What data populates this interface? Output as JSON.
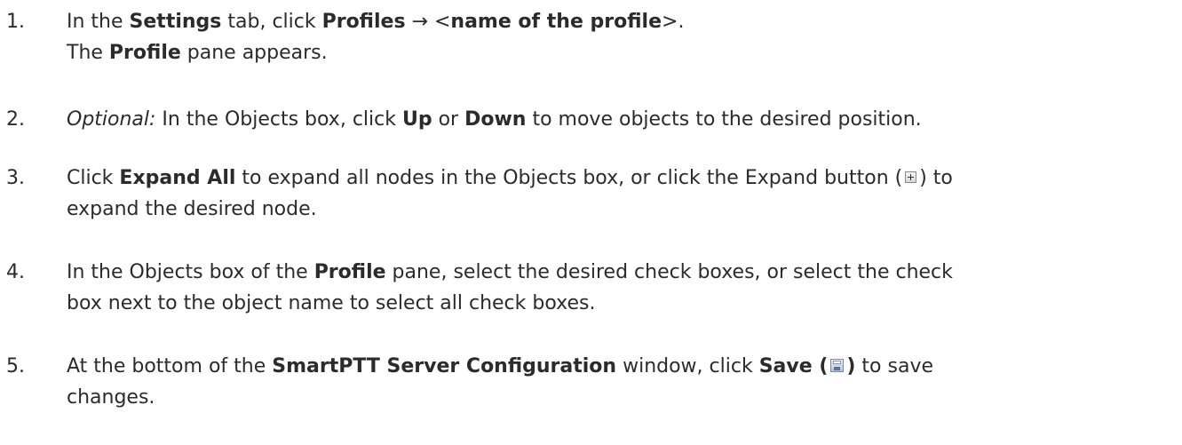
{
  "steps": [
    {
      "number": "1.",
      "lines": [
        [
          {
            "t": "In the ",
            "s": ""
          },
          {
            "t": "Settings",
            "s": "b"
          },
          {
            "t": " tab, click ",
            "s": ""
          },
          {
            "t": "Profiles",
            "s": "b"
          },
          {
            "t": " → <",
            "s": ""
          },
          {
            "t": "name of the profile",
            "s": "b"
          },
          {
            "t": ">.",
            "s": ""
          }
        ],
        [
          {
            "t": "The ",
            "s": ""
          },
          {
            "t": "Profile",
            "s": "b"
          },
          {
            "t": " pane appears.",
            "s": ""
          }
        ]
      ]
    },
    {
      "number": "2.",
      "lines": [
        [
          {
            "t": "Optional:",
            "s": "i"
          },
          {
            "t": " In the Objects box, click ",
            "s": ""
          },
          {
            "t": "Up",
            "s": "b"
          },
          {
            "t": " or ",
            "s": ""
          },
          {
            "t": "Down",
            "s": "b"
          },
          {
            "t": " to move objects to the desired position.",
            "s": ""
          }
        ]
      ]
    },
    {
      "number": "3.",
      "lines": [
        [
          {
            "t": "Click ",
            "s": ""
          },
          {
            "t": "Expand All",
            "s": "b"
          },
          {
            "t": " to expand all nodes in the Objects box, or click the Expand button (",
            "s": ""
          },
          {
            "icon": "expand-icon"
          },
          {
            "t": ") to",
            "s": ""
          }
        ],
        [
          {
            "t": "expand the desired node.",
            "s": ""
          }
        ]
      ]
    },
    {
      "number": "4.",
      "lines": [
        [
          {
            "t": "In the Objects box of the ",
            "s": ""
          },
          {
            "t": "Profile",
            "s": "b"
          },
          {
            "t": " pane, select the desired check boxes, or select the check",
            "s": ""
          }
        ],
        [
          {
            "t": "box next to the object name to select all check boxes.",
            "s": ""
          }
        ]
      ]
    },
    {
      "number": "5.",
      "lines": [
        [
          {
            "t": "At the bottom of the ",
            "s": ""
          },
          {
            "t": "SmartPTT Server Configuration",
            "s": "b"
          },
          {
            "t": " window, click ",
            "s": ""
          },
          {
            "t": "Save (",
            "s": "b"
          },
          {
            "icon": "save-icon"
          },
          {
            "t": ")",
            "s": "b"
          },
          {
            "t": " to save",
            "s": ""
          }
        ],
        [
          {
            "t": "changes.",
            "s": ""
          }
        ]
      ]
    }
  ]
}
